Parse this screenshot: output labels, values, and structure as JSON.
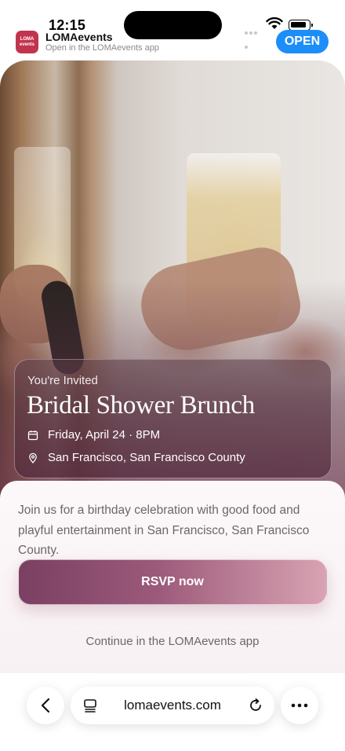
{
  "status_bar": {
    "time": "12:15"
  },
  "app_banner": {
    "icon_text": "LOMA events",
    "name": "LOMAevents",
    "subtitle": "Open in the LOMAevents app",
    "open_label": "OPEN"
  },
  "event": {
    "invited_label": "You're Invited",
    "title": "Bridal Shower Brunch",
    "date": "Friday, April 24 · 8PM",
    "location": "San Francisco, San Francisco County",
    "description": "Join us for a birthday celebration with good food and playful entertainment in San Francisco, San Francisco County.",
    "rsvp_label": "RSVP now",
    "continue_label": "Continue in the LOMAevents app"
  },
  "browser": {
    "url": "lomaevents.com"
  },
  "colors": {
    "accent": "#1c8ef9",
    "brand": "#c2344e",
    "rsvp_start": "#7a3f62",
    "rsvp_end": "#d9a3b3"
  }
}
